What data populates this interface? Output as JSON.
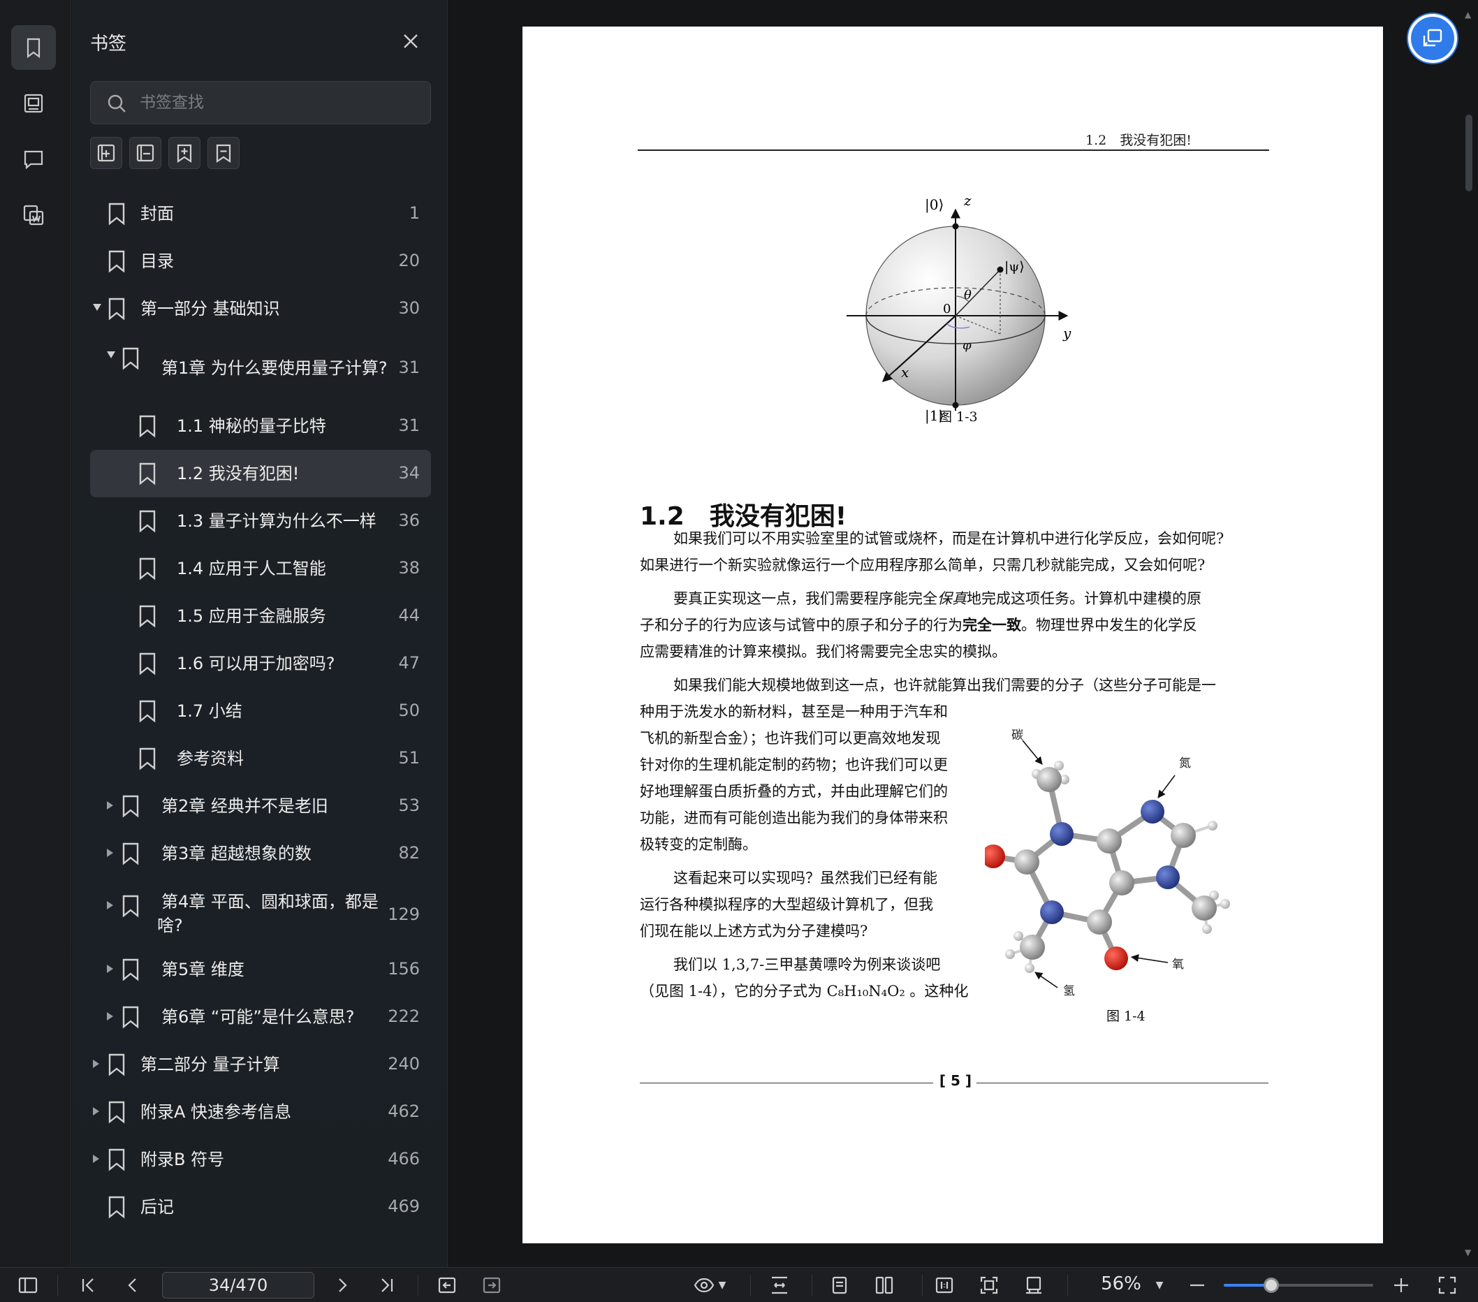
{
  "sidebar_panel": {
    "title": "书签",
    "search_placeholder": "书签查找",
    "items": [
      {
        "label": "封面",
        "page": "1",
        "level": 0,
        "caret": "none"
      },
      {
        "label": "目录",
        "page": "20",
        "level": 0,
        "caret": "none"
      },
      {
        "label": "第一部分 基础知识",
        "page": "30",
        "level": 0,
        "caret": "open"
      },
      {
        "label": "第1章 为什么要使用量子计算?",
        "page": "31",
        "level": 1,
        "caret": "open"
      },
      {
        "label": "1.1 神秘的量子比特",
        "page": "31",
        "level": 2,
        "caret": "none"
      },
      {
        "label": "1.2 我没有犯困!",
        "page": "34",
        "level": 2,
        "caret": "none",
        "selected": true
      },
      {
        "label": "1.3 量子计算为什么不一样",
        "page": "36",
        "level": 2,
        "caret": "none"
      },
      {
        "label": "1.4 应用于人工智能",
        "page": "38",
        "level": 2,
        "caret": "none"
      },
      {
        "label": "1.5 应用于金融服务",
        "page": "44",
        "level": 2,
        "caret": "none"
      },
      {
        "label": "1.6 可以用于加密吗?",
        "page": "47",
        "level": 2,
        "caret": "none"
      },
      {
        "label": "1.7 小结",
        "page": "50",
        "level": 2,
        "caret": "none"
      },
      {
        "label": "参考资料",
        "page": "51",
        "level": 2,
        "caret": "none"
      },
      {
        "label": "第2章 经典并不是老旧",
        "page": "53",
        "level": 1,
        "caret": "closed"
      },
      {
        "label": "第3章 超越想象的数",
        "page": "82",
        "level": 1,
        "caret": "closed"
      },
      {
        "label": "第4章 平面、圆和球面，都是啥?",
        "page": "129",
        "level": 1,
        "caret": "closed",
        "lines": [
          "第4章 平面、圆和球面，都是",
          "啥?"
        ]
      },
      {
        "label": "第5章 维度",
        "page": "156",
        "level": 1,
        "caret": "closed"
      },
      {
        "label": "第6章 “可能”是什么意思?",
        "page": "222",
        "level": 1,
        "caret": "closed"
      },
      {
        "label": "第二部分 量子计算",
        "page": "240",
        "level": 0,
        "caret": "closed"
      },
      {
        "label": "附录A 快速参考信息",
        "page": "462",
        "level": 0,
        "caret": "closed"
      },
      {
        "label": "附录B 符号",
        "page": "466",
        "level": 0,
        "caret": "closed"
      },
      {
        "label": "后记",
        "page": "469",
        "level": 0,
        "caret": "none"
      }
    ]
  },
  "document": {
    "running_head": "1.2　我没有犯困!",
    "figure_1_3": {
      "caption": "图 1-3",
      "labels": {
        "top": "|0⟩",
        "bottom": "|1⟩",
        "z": "z",
        "y": "y",
        "x": "x",
        "psi": "|ψ⟩",
        "theta": "θ",
        "phi": "φ",
        "origin": "0"
      }
    },
    "section_heading": "1.2　我没有犯困!",
    "p1_lines": [
      "如果我们可以不用实验室里的试管或烧杯，而是在计算机中进行化学反应，会如何呢?",
      "如果进行一个新实验就像运行一个应用程序那么简单，只需几秒就能完成，又会如何呢?"
    ],
    "p2_line1_a": "要真正实现这一点，我们需要程序能完全",
    "p2_line1_em": "保真",
    "p2_line1_b": "地完成这项任务。计算机中建模的原",
    "p2_line2_a": "子和分子的行为应该与试管中的原子和分子的行为",
    "p2_line2_strong": "完全一致",
    "p2_line2_b": "。物理世界中发生的化学反",
    "p2_line3": "应需要精准的计算来模拟。我们将需要完全忠实的模拟。",
    "p3_line1": "如果我们能大规模地做到这一点，也许就能算出我们需要的分子（这些分子可能是一",
    "p3_lines": [
      "种用于洗发水的新材料，甚至是一种用于汽车和",
      "飞机的新型合金）；也许我们可以更高效地发现",
      "针对你的生理机能定制的药物；也许我们可以更",
      "好地理解蛋白质折叠的方式，并由此理解它们的",
      "功能，进而有可能创造出能为我们的身体带来积",
      "极转变的定制酶。"
    ],
    "p4_lines": [
      "这看起来可以实现吗？虽然我们已经有能",
      "运行各种模拟程序的大型超级计算机了，但我",
      "们现在能以上述方式为分子建模吗?"
    ],
    "p5_line1": "我们以 1,3,7-三甲基黄嘌呤为例来谈谈吧",
    "p5_line2": "（见图 1-4），它的分子式为 C₈H₁₀N₄O₂ 。这种化",
    "figure_1_4": {
      "caption": "图 1-4",
      "labels": {
        "carbon": "碳",
        "nitrogen": "氮",
        "oxygen": "氧",
        "hydrogen": "氢"
      }
    },
    "page_number": "5"
  },
  "toolbar": {
    "page_indicator": "34/470",
    "zoom": "56%",
    "zoom_level": 0.32
  }
}
